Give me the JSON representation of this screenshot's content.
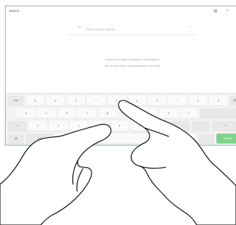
{
  "app": {
    "title": "Search"
  },
  "top_icons": [
    "keyboard-icon",
    "close-icon"
  ],
  "search": {
    "icon": "search-icon",
    "placeholder": "Search (tap for options)"
  },
  "message": {
    "line1": "Search for a contact, bookmark or video address",
    "line2": "You can use names, email addresses or SIP URIs"
  },
  "keyboard": {
    "rows": [
      [
        "q",
        "w",
        "e",
        "r",
        "t",
        "y",
        "u",
        "i",
        "o",
        "p"
      ],
      [
        "a",
        "s",
        "d",
        "f",
        "g",
        "h",
        "j",
        "k",
        "l"
      ],
      [
        "z",
        "x",
        "c",
        "v",
        "b",
        "n",
        "m"
      ]
    ],
    "special": {
      "tab": "tab",
      "backspace": "⌫",
      "caps": "⇧",
      "shift": "⇧",
      "lang": "🌐",
      "numbers": "123",
      "space": "",
      "enter": "Search"
    },
    "colors": {
      "enter": "#7ed389"
    }
  }
}
